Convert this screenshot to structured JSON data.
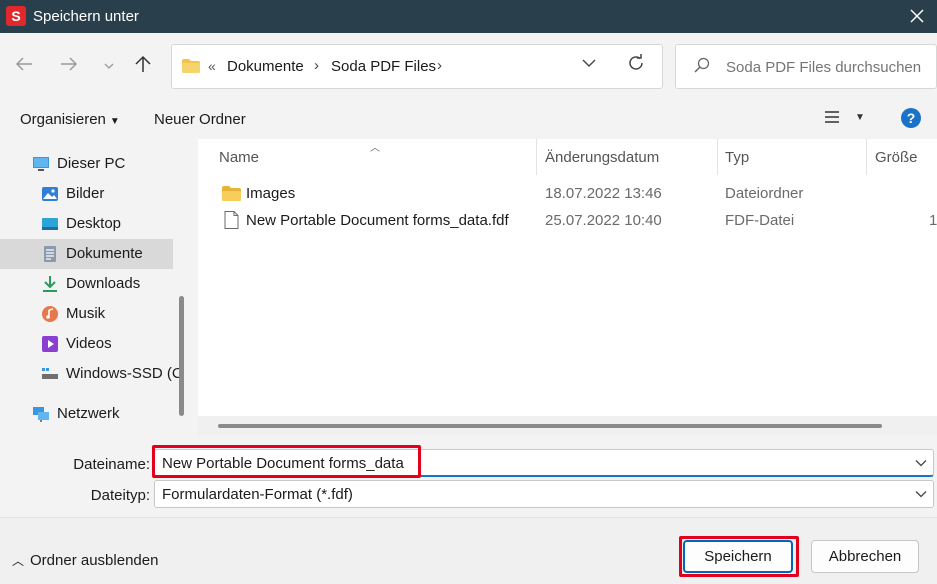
{
  "window": {
    "title": "Speichern unter",
    "app_logo_letter": "S",
    "close_icon": "close-icon"
  },
  "nav": {
    "back_icon": "arrow-left-icon",
    "forward_icon": "arrow-right-icon",
    "recent_icon": "chevron-down-icon",
    "up_icon": "arrow-up-icon",
    "address": {
      "overflow": "«",
      "segments": [
        "Dokumente",
        "Soda PDF Files"
      ],
      "separator": "›",
      "dropdown_icon": "chevron-down-icon",
      "refresh_icon": "refresh-icon"
    },
    "search": {
      "placeholder": "Soda PDF Files durchsuchen",
      "icon": "search-icon"
    }
  },
  "toolbar": {
    "organize_label": "Organisieren",
    "new_folder_label": "Neuer Ordner",
    "view_icon": "list-view-icon",
    "help_label": "?"
  },
  "sidebar": {
    "items": [
      {
        "label": "Dieser PC",
        "icon": "computer-icon",
        "selected": false
      },
      {
        "label": "Bilder",
        "icon": "pictures-icon",
        "selected": false
      },
      {
        "label": "Desktop",
        "icon": "desktop-icon",
        "selected": false
      },
      {
        "label": "Dokumente",
        "icon": "documents-icon",
        "selected": true
      },
      {
        "label": "Downloads",
        "icon": "download-icon",
        "selected": false
      },
      {
        "label": "Musik",
        "icon": "music-icon",
        "selected": false
      },
      {
        "label": "Videos",
        "icon": "video-icon",
        "selected": false
      },
      {
        "label": "Windows-SSD (C",
        "icon": "drive-icon",
        "selected": false
      },
      {
        "label": "Netzwerk",
        "icon": "network-icon",
        "selected": false
      }
    ]
  },
  "files": {
    "columns": [
      "Name",
      "Änderungsdatum",
      "Typ",
      "Größe"
    ],
    "rows": [
      {
        "name": "Images",
        "date": "18.07.2022 13:46",
        "type": "Dateiordner",
        "size": "",
        "icon": "folder-icon"
      },
      {
        "name": "New Portable Document forms_data.fdf",
        "date": "25.07.2022 10:40",
        "type": "FDF-Datei",
        "size": "1",
        "icon": "file-icon"
      }
    ]
  },
  "form": {
    "filename_label": "Dateiname:",
    "filename_value": "New Portable Document forms_data",
    "filetype_label": "Dateityp:",
    "filetype_value": "Formulardaten-Format (*.fdf)"
  },
  "footer": {
    "toggle_label": "Ordner ausblenden",
    "save_label": "Speichern",
    "cancel_label": "Abbrechen"
  },
  "colors": {
    "titlebar": "#2a3f4c",
    "accent": "#0067c0",
    "highlight": "#e3001b",
    "app_logo": "#e0282d"
  }
}
